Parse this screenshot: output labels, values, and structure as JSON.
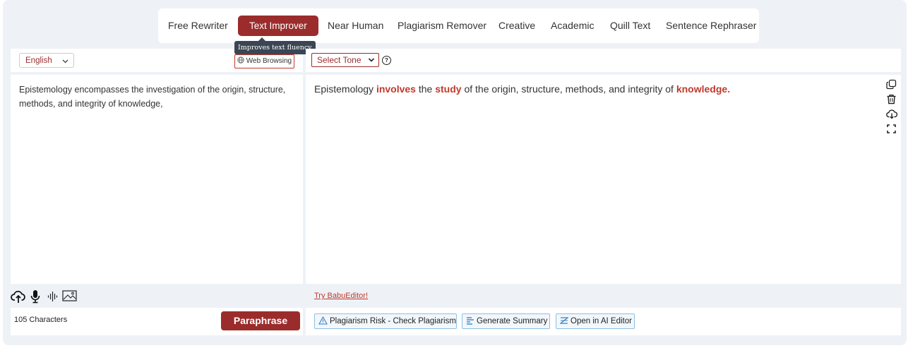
{
  "modes": {
    "tabs": [
      {
        "label": "Free Rewriter"
      },
      {
        "label": "Text Improver"
      },
      {
        "label": "Near Human"
      },
      {
        "label": "Plagiarism Remover"
      },
      {
        "label": "Creative"
      },
      {
        "label": "Academic"
      },
      {
        "label": "Quill Text"
      },
      {
        "label": "Sentence Rephraser"
      }
    ],
    "active": "Text Improver",
    "tooltip": "Improves text fluency"
  },
  "input_panel": {
    "language": "English",
    "web_browsing_label": "Web Browsing",
    "text": "Epistemology encompasses the investigation of the origin, structure, methods, and integrity of knowledge,",
    "char_count": "105 Characters",
    "paraphrase_label": "Paraphrase"
  },
  "output_panel": {
    "tone_placeholder": "Select Tone",
    "help_glyph": "?",
    "segments": [
      {
        "text": "Epistemology ",
        "changed": false
      },
      {
        "text": "involves",
        "changed": true
      },
      {
        "text": " the ",
        "changed": false
      },
      {
        "text": "study",
        "changed": true
      },
      {
        "text": " of the origin, structure, methods, and integrity of ",
        "changed": false
      },
      {
        "text": "knowledge.",
        "changed": true
      }
    ],
    "try_link": "Try BabuEditor!",
    "actions": [
      {
        "label": "Plagiarism Risk - Check Plagiarism",
        "icon": "warning-icon"
      },
      {
        "label": "Generate Summary",
        "icon": "summary-icon"
      },
      {
        "label": "Open in AI Editor",
        "icon": "editor-icon"
      }
    ]
  },
  "colors": {
    "brand": "#9b2c2c",
    "highlight": "#c0392b",
    "background": "#eef2f7"
  }
}
